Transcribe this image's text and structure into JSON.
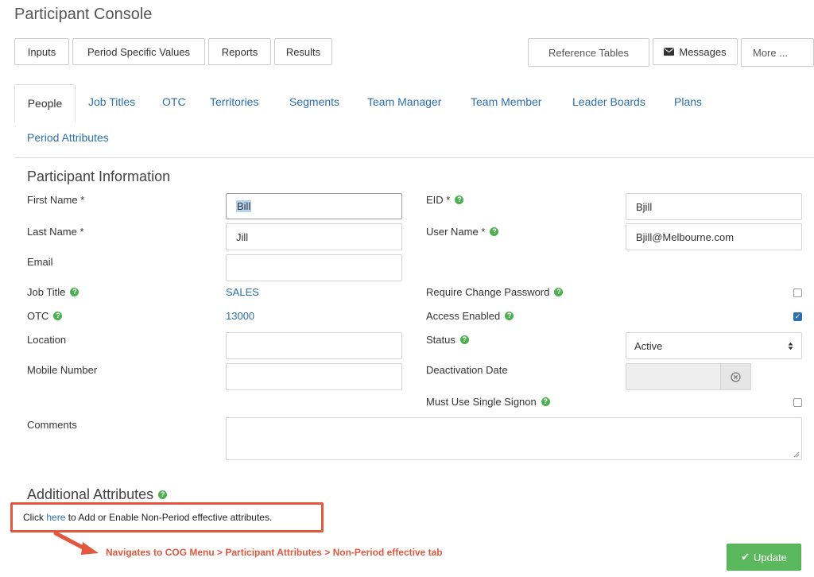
{
  "app": {
    "title": "Participant Console"
  },
  "toolbar": {
    "left": [
      "Inputs",
      "Period Specific Values",
      "Reports",
      "Results"
    ],
    "reference_tables": "Reference Tables",
    "messages": "Messages",
    "more": "More ..."
  },
  "tabs": [
    "People",
    "Job Titles",
    "OTC",
    "Territories",
    "Segments",
    "Team Manager",
    "Team Member",
    "Leader Boards",
    "Plans",
    "Period Attributes"
  ],
  "active_tab": "People",
  "section": {
    "title": "Participant Information",
    "first_name": {
      "label": "First Name *",
      "value": "Bill"
    },
    "last_name": {
      "label": "Last Name *",
      "value": "Jill"
    },
    "email": {
      "label": "Email",
      "value": ""
    },
    "job_title": {
      "label": "Job Title",
      "value": "SALES"
    },
    "otc": {
      "label": "OTC",
      "value": "13000"
    },
    "location": {
      "label": "Location",
      "value": ""
    },
    "mobile": {
      "label": "Mobile Number",
      "value": ""
    },
    "comments": {
      "label": "Comments",
      "value": ""
    },
    "eid": {
      "label": "EID *",
      "value": "Bjill"
    },
    "username": {
      "label": "User Name *",
      "value": "Bjill@Melbourne.com"
    },
    "require_change_password": {
      "label": "Require Change Password",
      "checked": false
    },
    "access_enabled": {
      "label": "Access Enabled",
      "checked": true
    },
    "status": {
      "label": "Status",
      "value": "Active"
    },
    "deactivation_date": {
      "label": "Deactivation Date",
      "value": ""
    },
    "single_signon": {
      "label": "Must Use Single Signon",
      "checked": false
    }
  },
  "additional": {
    "title": "Additional Attributes",
    "text_before": "Click ",
    "link": "here",
    "text_after": " to Add or Enable Non-Period effective attributes."
  },
  "annotation": "Navigates to COG Menu > Participant Attributes > Non-Period effective tab",
  "update_button": "Update",
  "colors": {
    "link": "#2a6fb0",
    "accent_red": "#e1583f",
    "success": "#5cb85c",
    "help": "#4caf50"
  }
}
